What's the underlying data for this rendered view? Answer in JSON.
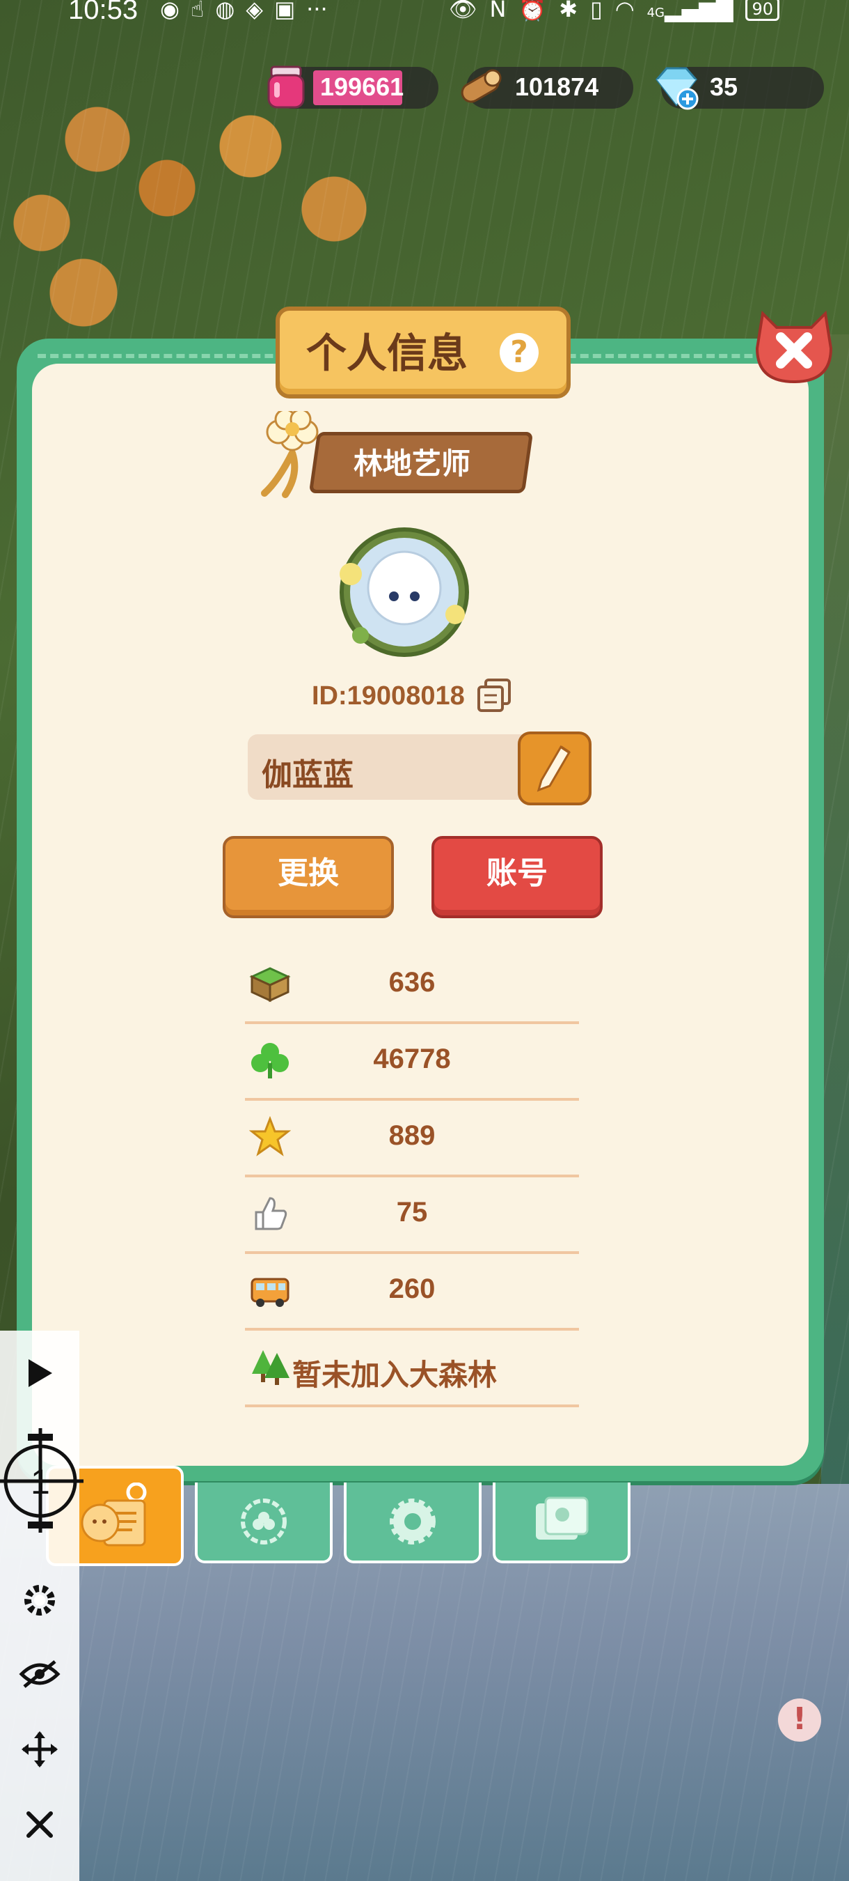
{
  "status_bar": {
    "time": "10:53",
    "battery": "90",
    "network": "4G"
  },
  "currencies": [
    {
      "name": "potion",
      "icon": "potion-jar-icon",
      "value": "199661"
    },
    {
      "name": "wood",
      "icon": "wood-log-icon",
      "value": "101874"
    },
    {
      "name": "diamond",
      "icon": "diamond-plus-icon",
      "value": "35"
    }
  ],
  "panel": {
    "title": "个人信息",
    "help_label": "?",
    "rank_title": "林地艺师",
    "player_id": "ID:19008018",
    "player_name": "伽蓝蓝",
    "change_button": "更换",
    "account_button": "账号"
  },
  "stats": [
    {
      "icon": "grass-block-icon",
      "value": "636"
    },
    {
      "icon": "clover-icon",
      "value": "46778"
    },
    {
      "icon": "star-icon",
      "value": "889"
    },
    {
      "icon": "thumbs-up-icon",
      "value": "75"
    },
    {
      "icon": "bus-icon",
      "value": "260"
    }
  ],
  "forest": {
    "icon": "trees-icon",
    "label": "暂未加入大森林"
  },
  "tabs": [
    {
      "name": "profile",
      "icon": "profile-card-icon",
      "active": true
    },
    {
      "name": "badges",
      "icon": "badge-icon",
      "active": false
    },
    {
      "name": "settings",
      "icon": "gear-icon",
      "active": false
    },
    {
      "name": "album",
      "icon": "photo-album-icon",
      "active": false
    }
  ],
  "overlay_toolbar": {
    "crosshair_number": "1"
  },
  "colors": {
    "panel_green": "#4db583",
    "panel_cream": "#fbf3e2",
    "text_brown": "#9a5227",
    "button_orange": "#e7953a",
    "button_red": "#e34a44",
    "active_tab": "#f7a11e"
  }
}
